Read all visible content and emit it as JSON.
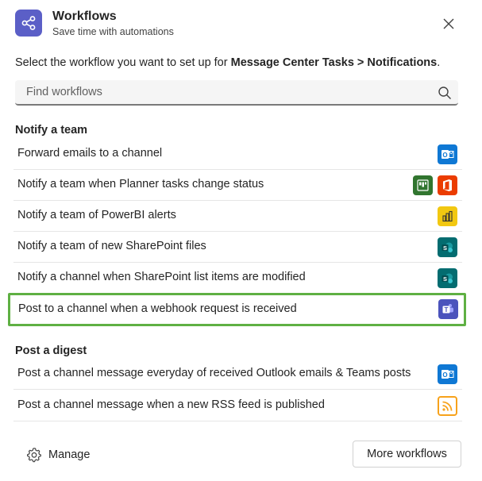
{
  "header": {
    "title": "Workflows",
    "subtitle": "Save time with automations",
    "app_icon": "share-nodes-icon",
    "close_icon": "close-icon"
  },
  "instruction": {
    "prefix": "Select the workflow you want to set up for ",
    "target": "Message Center Tasks > Notifications",
    "suffix": "."
  },
  "search": {
    "placeholder": "Find workflows",
    "value": "",
    "icon": "search-icon"
  },
  "sections": [
    {
      "title": "Notify a team",
      "items": [
        {
          "label": "Forward emails to a channel",
          "icons": [
            "outlook-icon"
          ]
        },
        {
          "label": "Notify a team when Planner tasks change status",
          "icons": [
            "planner-icon",
            "office-icon"
          ]
        },
        {
          "label": "Notify a team of PowerBI alerts",
          "icons": [
            "powerbi-icon"
          ]
        },
        {
          "label": "Notify a team of new SharePoint files",
          "icons": [
            "sharepoint-icon"
          ]
        },
        {
          "label": "Notify a channel when SharePoint list items are modified",
          "icons": [
            "sharepoint-icon"
          ]
        },
        {
          "label": "Post to a channel when a webhook request is received",
          "icons": [
            "teams-icon"
          ],
          "highlighted": true
        }
      ]
    },
    {
      "title": "Post a digest",
      "items": [
        {
          "label": "Post a channel message everyday of received Outlook emails & Teams posts",
          "icons": [
            "outlook-icon"
          ]
        },
        {
          "label": "Post a channel message when a new RSS feed is published",
          "icons": [
            "rss-icon"
          ]
        }
      ]
    }
  ],
  "footer": {
    "manage_label": "Manage",
    "manage_icon": "gear-icon",
    "more_label": "More workflows"
  },
  "colors": {
    "accent": "#5b5fc7",
    "highlight_border": "#5fb043",
    "outlook": "#0f78d4",
    "planner": "#31752f",
    "office": "#eb3c00",
    "powerbi": "#f2c811",
    "sharepoint": "#036c70",
    "teams": "#4b53bc",
    "rss": "#f7a21b"
  }
}
